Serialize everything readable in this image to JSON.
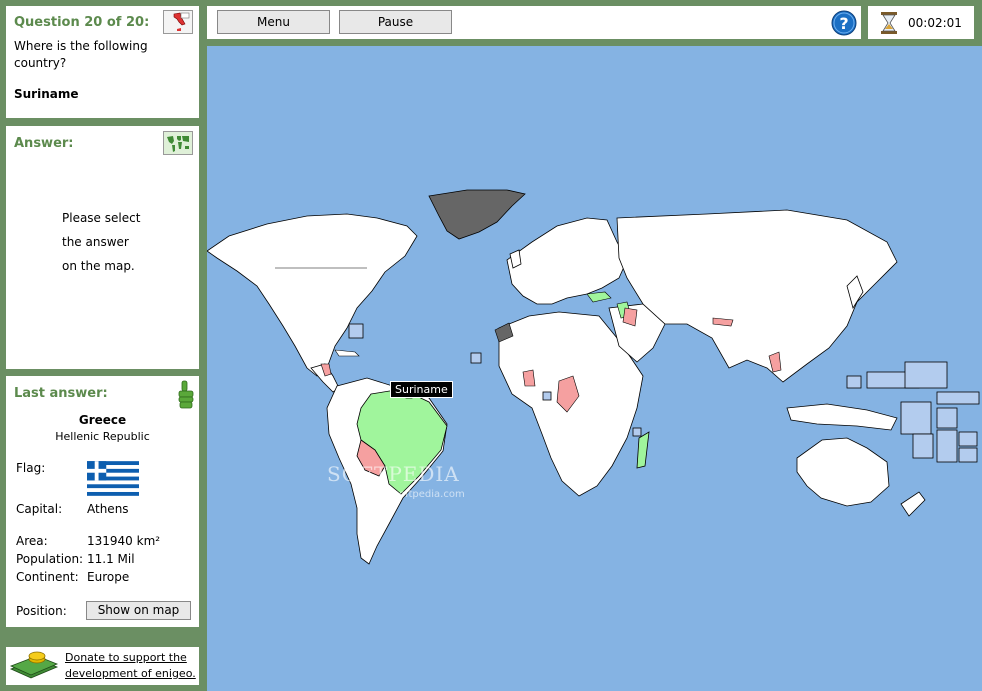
{
  "question": {
    "title": "Question 20 of 20:",
    "text": "Where is the following country?",
    "country": "Suriname"
  },
  "answer": {
    "title": "Answer:",
    "message_lines": [
      "Please select",
      "the answer",
      "on the map."
    ]
  },
  "last_answer": {
    "title": "Last answer:",
    "country": "Greece",
    "official_name": "Hellenic Republic",
    "flag_label": "Flag:",
    "capital_label": "Capital:",
    "capital": "Athens",
    "area_label": "Area:",
    "area": "131940 km²",
    "population_label": "Population:",
    "population": "11.1 Mil",
    "continent_label": "Continent:",
    "continent": "Europe",
    "position_label": "Position:",
    "show_button": "Show on map"
  },
  "donate": {
    "line1": "Donate to support the",
    "line2": "development of enigeo."
  },
  "toolbar": {
    "menu": "Menu",
    "pause": "Pause",
    "help_icon": "question-mark-icon"
  },
  "timer": {
    "icon": "hourglass-icon",
    "value": "00:02:01"
  },
  "map": {
    "tooltip": "Suriname",
    "watermark": "SOFTPEDIA",
    "watermark_sub": "www.softpedia.com",
    "colors": {
      "ocean": "#85b3e3",
      "land": "#ffffff",
      "correct": "#a0f59c",
      "wrong": "#f5a0a0",
      "visited": "#666666",
      "islands": "#b3ccee"
    }
  }
}
